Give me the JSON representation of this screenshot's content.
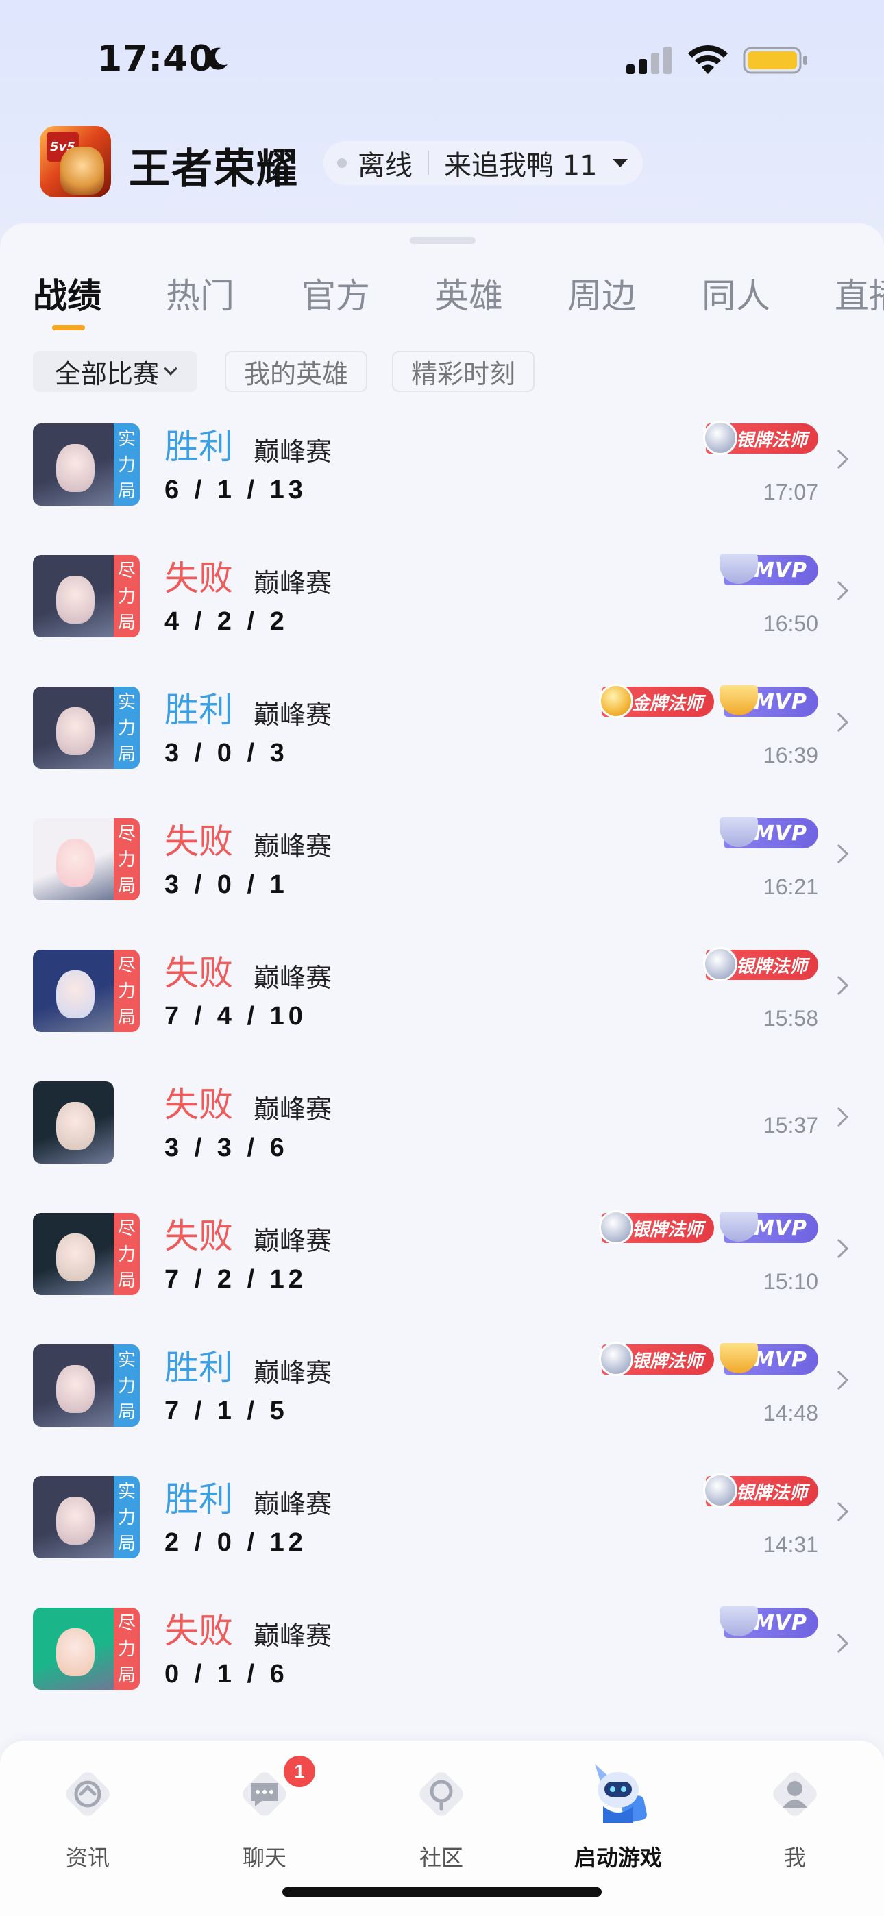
{
  "status_bar": {
    "time": "17:40",
    "icons": [
      "moon-icon",
      "cellular-signal-icon",
      "wifi-icon",
      "battery-icon"
    ]
  },
  "header": {
    "app_title": "王者荣耀",
    "logo_badge": "5v5",
    "account_status": "离线",
    "account_name": "来追我鸭 11"
  },
  "tabs": [
    "战绩",
    "热门",
    "官方",
    "英雄",
    "周边",
    "同人",
    "直播"
  ],
  "active_tab": "战绩",
  "filters": [
    "全部比赛",
    "我的英雄",
    "精彩时刻"
  ],
  "matches": [
    {
      "result": "胜利",
      "outcome": "win",
      "mode": "巅峰赛",
      "kda": "6 / 1 / 13",
      "time": "17:07",
      "tag": "实力局",
      "tag_color": "blue",
      "badges": [
        {
          "type": "silver",
          "label": "银牌法师"
        }
      ]
    },
    {
      "result": "失败",
      "outcome": "lose",
      "mode": "巅峰赛",
      "kda": "4 / 2 / 2",
      "time": "16:50",
      "tag": "尽力局",
      "tag_color": "red",
      "badges": [
        {
          "type": "mvp-silver",
          "label": "MVP"
        }
      ]
    },
    {
      "result": "胜利",
      "outcome": "win",
      "mode": "巅峰赛",
      "kda": "3 / 0 / 3",
      "time": "16:39",
      "tag": "实力局",
      "tag_color": "blue",
      "badges": [
        {
          "type": "gold",
          "label": "金牌法师"
        },
        {
          "type": "mvp-gold",
          "label": "MVP"
        }
      ]
    },
    {
      "result": "失败",
      "outcome": "lose",
      "mode": "巅峰赛",
      "kda": "3 / 0 / 1",
      "time": "16:21",
      "tag": "尽力局",
      "tag_color": "red",
      "badges": [
        {
          "type": "mvp-silver",
          "label": "MVP"
        }
      ]
    },
    {
      "result": "失败",
      "outcome": "lose",
      "mode": "巅峰赛",
      "kda": "7 / 4 / 10",
      "time": "15:58",
      "tag": "尽力局",
      "tag_color": "red",
      "badges": [
        {
          "type": "silver",
          "label": "银牌法师"
        }
      ]
    },
    {
      "result": "失败",
      "outcome": "lose",
      "mode": "巅峰赛",
      "kda": "3 / 3 / 6",
      "time": "15:37",
      "tag": "",
      "tag_color": "",
      "badges": []
    },
    {
      "result": "失败",
      "outcome": "lose",
      "mode": "巅峰赛",
      "kda": "7 / 2 / 12",
      "time": "15:10",
      "tag": "尽力局",
      "tag_color": "red",
      "badges": [
        {
          "type": "silver",
          "label": "银牌法师"
        },
        {
          "type": "mvp-silver",
          "label": "MVP"
        }
      ]
    },
    {
      "result": "胜利",
      "outcome": "win",
      "mode": "巅峰赛",
      "kda": "7 / 1 / 5",
      "time": "14:48",
      "tag": "实力局",
      "tag_color": "blue",
      "badges": [
        {
          "type": "silver",
          "label": "银牌法师"
        },
        {
          "type": "mvp-gold",
          "label": "MVP"
        }
      ]
    },
    {
      "result": "胜利",
      "outcome": "win",
      "mode": "巅峰赛",
      "kda": "2 / 0 / 12",
      "time": "14:31",
      "tag": "实力局",
      "tag_color": "blue",
      "badges": [
        {
          "type": "silver",
          "label": "银牌法师"
        }
      ]
    },
    {
      "result": "失败",
      "outcome": "lose",
      "mode": "巅峰赛",
      "kda": "0 / 1 / 6",
      "time": "",
      "tag": "尽力局",
      "tag_color": "red",
      "badges": [
        {
          "type": "mvp-silver",
          "label": "MVP"
        }
      ]
    }
  ],
  "bottom_nav": [
    {
      "label": "资讯",
      "icon": "news-icon"
    },
    {
      "label": "聊天",
      "icon": "chat-icon",
      "badge": "1"
    },
    {
      "label": "社区",
      "icon": "community-icon"
    },
    {
      "label": "启动游戏",
      "icon": "launch-game-robot-icon",
      "active": true
    },
    {
      "label": "我",
      "icon": "profile-icon"
    }
  ],
  "colors": {
    "win": "#3d9fe3",
    "lose": "#f05a5a",
    "tab_accent": "#f6a623",
    "mvp": "#7a6fe8"
  }
}
